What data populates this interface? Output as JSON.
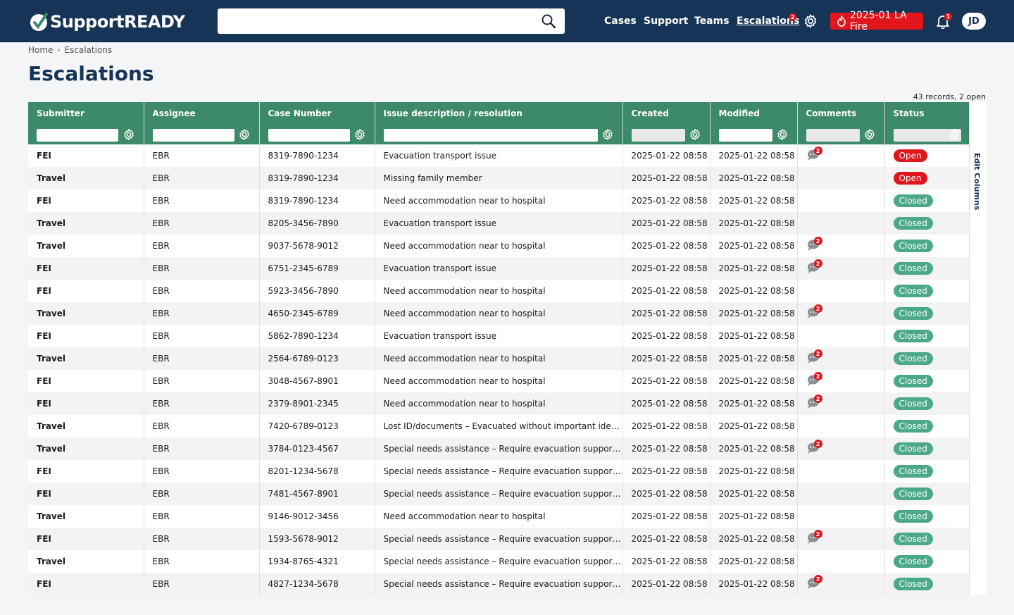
{
  "header": {
    "brand": "SupportREADY",
    "search": {
      "value": "",
      "placeholder": ""
    },
    "nav": [
      {
        "label": "Cases",
        "active": false
      },
      {
        "label": "Support",
        "active": false
      },
      {
        "label": "Teams",
        "active": false
      },
      {
        "label": "Escalations",
        "active": true,
        "badge": "2"
      }
    ],
    "incident": "2025-01 LA Fire",
    "notifications_badge": "1",
    "user_initials": "JD",
    "colors": {
      "bar": "#163456",
      "accent": "#e0161c"
    }
  },
  "breadcrumb": {
    "home": "Home",
    "current": "Escalations"
  },
  "page": {
    "title": "Escalations",
    "records": "43 records, 2 open"
  },
  "table": {
    "columns": [
      "Submitter",
      "Assignee",
      "Case Number",
      "Issue description / resolution",
      "Created",
      "Modified",
      "Comments",
      "Status"
    ],
    "edit_columns_label": "Edit Columns",
    "rows": [
      {
        "submitter": "FEI",
        "assignee": "EBR",
        "case": "8319-7890-1234",
        "issue": "Evacuation transport issue",
        "created": "2025-01-22 08:58",
        "modified": "2025-01-22 08:58",
        "comments": "2",
        "status": "Open"
      },
      {
        "submitter": "Travel",
        "assignee": "EBR",
        "case": "8319-7890-1234",
        "issue": "Missing family member",
        "created": "2025-01-22 08:58",
        "modified": "2025-01-22 08:58",
        "comments": "",
        "status": "Open"
      },
      {
        "submitter": "FEI",
        "assignee": "EBR",
        "case": "8319-7890-1234",
        "issue": "Need accommodation near to hospital",
        "created": "2025-01-22 08:58",
        "modified": "2025-01-22 08:58",
        "comments": "",
        "status": "Closed"
      },
      {
        "submitter": "Travel",
        "assignee": "EBR",
        "case": "8205-3456-7890",
        "issue": "Evacuation transport issue",
        "created": "2025-01-22 08:58",
        "modified": "2025-01-22 08:58",
        "comments": "",
        "status": "Closed"
      },
      {
        "submitter": "Travel",
        "assignee": "EBR",
        "case": "9037-5678-9012",
        "issue": "Need accommodation near to hospital",
        "created": "2025-01-22 08:58",
        "modified": "2025-01-22 08:58",
        "comments": "2",
        "status": "Closed"
      },
      {
        "submitter": "FEI",
        "assignee": "EBR",
        "case": "6751-2345-6789",
        "issue": "Evacuation transport issue",
        "created": "2025-01-22 08:58",
        "modified": "2025-01-22 08:58",
        "comments": "2",
        "status": "Closed"
      },
      {
        "submitter": "FEI",
        "assignee": "EBR",
        "case": "5923-3456-7890",
        "issue": "Need accommodation near to hospital",
        "created": "2025-01-22 08:58",
        "modified": "2025-01-22 08:58",
        "comments": "",
        "status": "Closed"
      },
      {
        "submitter": "Travel",
        "assignee": "EBR",
        "case": "4650-2345-6789",
        "issue": "Need accommodation near to hospital",
        "created": "2025-01-22 08:58",
        "modified": "2025-01-22 08:58",
        "comments": "2",
        "status": "Closed"
      },
      {
        "submitter": "FEI",
        "assignee": "EBR",
        "case": "5862-7890-1234",
        "issue": "Evacuation transport issue",
        "created": "2025-01-22 08:58",
        "modified": "2025-01-22 08:58",
        "comments": "",
        "status": "Closed"
      },
      {
        "submitter": "Travel",
        "assignee": "EBR",
        "case": "2564-6789-0123",
        "issue": "Need accommodation near to hospital",
        "created": "2025-01-22 08:58",
        "modified": "2025-01-22 08:58",
        "comments": "2",
        "status": "Closed"
      },
      {
        "submitter": "FEI",
        "assignee": "EBR",
        "case": "3048-4567-8901",
        "issue": "Need accommodation near to hospital",
        "created": "2025-01-22 08:58",
        "modified": "2025-01-22 08:58",
        "comments": "2",
        "status": "Closed"
      },
      {
        "submitter": "FEI",
        "assignee": "EBR",
        "case": "2379-8901-2345",
        "issue": "Need accommodation near to hospital",
        "created": "2025-01-22 08:58",
        "modified": "2025-01-22 08:58",
        "comments": "2",
        "status": "Closed"
      },
      {
        "submitter": "Travel",
        "assignee": "EBR",
        "case": "7420-6789-0123",
        "issue": "Lost ID/documents – Evacuated without important identi…",
        "created": "2025-01-22 08:58",
        "modified": "2025-01-22 08:58",
        "comments": "",
        "status": "Closed"
      },
      {
        "submitter": "Travel",
        "assignee": "EBR",
        "case": "3784-0123-4567",
        "issue": "Special needs assistance – Require evacuation support for…",
        "created": "2025-01-22 08:58",
        "modified": "2025-01-22 08:58",
        "comments": "2",
        "status": "Closed"
      },
      {
        "submitter": "FEI",
        "assignee": "EBR",
        "case": "8201-1234-5678",
        "issue": "Special needs assistance – Require evacuation support for…",
        "created": "2025-01-22 08:58",
        "modified": "2025-01-22 08:58",
        "comments": "",
        "status": "Closed"
      },
      {
        "submitter": "FEI",
        "assignee": "EBR",
        "case": "7481-4567-8901",
        "issue": "Special needs assistance – Require evacuation support for…",
        "created": "2025-01-22 08:58",
        "modified": "2025-01-22 08:58",
        "comments": "",
        "status": "Closed"
      },
      {
        "submitter": "Travel",
        "assignee": "EBR",
        "case": "9146-9012-3456",
        "issue": "Need accommodation near to hospital",
        "created": "2025-01-22 08:58",
        "modified": "2025-01-22 08:58",
        "comments": "",
        "status": "Closed"
      },
      {
        "submitter": "FEI",
        "assignee": "EBR",
        "case": "1593-5678-9012",
        "issue": "Special needs assistance – Require evacuation support for…",
        "created": "2025-01-22 08:58",
        "modified": "2025-01-22 08:58",
        "comments": "2",
        "status": "Closed"
      },
      {
        "submitter": "Travel",
        "assignee": "EBR",
        "case": "1934-8765-4321",
        "issue": "Special needs assistance – Require evacuation support for…",
        "created": "2025-01-22 08:58",
        "modified": "2025-01-22 08:58",
        "comments": "",
        "status": "Closed"
      },
      {
        "submitter": "FEI",
        "assignee": "EBR",
        "case": "4827-1234-5678",
        "issue": "Special needs assistance – Require evacuation support for…",
        "created": "2025-01-22 08:58",
        "modified": "2025-01-22 08:58",
        "comments": "2",
        "status": "Closed"
      }
    ]
  }
}
